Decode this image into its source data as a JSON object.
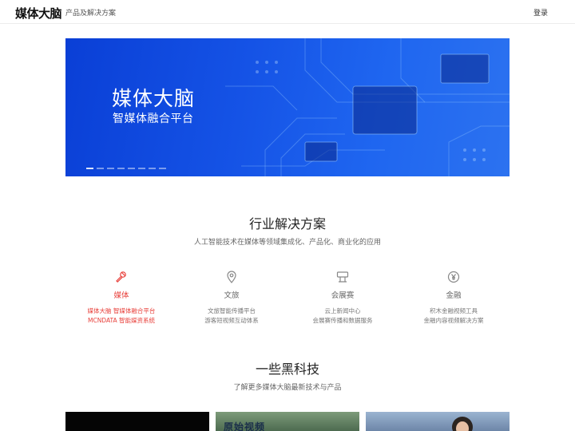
{
  "header": {
    "logo": "媒体大脑",
    "nav_item": "产品及解决方案",
    "login": "登录"
  },
  "banner": {
    "title": "媒体大脑",
    "subtitle": "智媒体融合平台",
    "slide_count": 8,
    "active_slide": 1
  },
  "solutions": {
    "title": "行业解决方案",
    "subtitle": "人工智能技术在媒体等领域集成化、产品化、商业化的应用",
    "accent_color": "#e8403b",
    "categories": [
      {
        "label": "媒体",
        "icon": "microphone-icon",
        "lines": [
          "媒体大脑 智媒体融合平台",
          "MCNDATA 智能媒资系统"
        ]
      },
      {
        "label": "文旅",
        "icon": "location-pin-icon",
        "lines": [
          "文旅智能传播平台",
          "游客短视频互动体系"
        ]
      },
      {
        "label": "会展赛",
        "icon": "podium-icon",
        "lines": [
          "云上新闻中心",
          "会展赛传播和数据服务"
        ]
      },
      {
        "label": "金融",
        "icon": "yen-coin-icon",
        "lines": [
          "积木金融视频工具",
          "金融内容视频解决方案"
        ]
      }
    ]
  },
  "tech": {
    "title": "一些黑科技",
    "subtitle": "了解更多媒体大脑最新技术与产品",
    "thumb2_overlay": "原始视频"
  }
}
